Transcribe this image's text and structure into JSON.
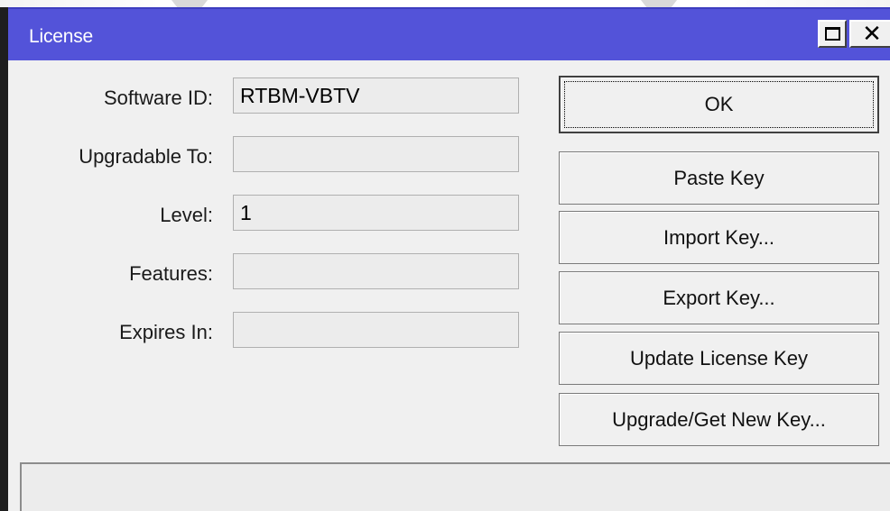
{
  "window": {
    "title": "License"
  },
  "fields": [
    {
      "label": "Software ID:",
      "value": "RTBM-VBTV"
    },
    {
      "label": "Upgradable To:",
      "value": ""
    },
    {
      "label": "Level:",
      "value": "1"
    },
    {
      "label": "Features:",
      "value": ""
    },
    {
      "label": "Expires In:",
      "value": ""
    }
  ],
  "buttons": {
    "ok": "OK",
    "paste_key": "Paste Key",
    "import_key": "Import Key...",
    "export_key": "Export Key...",
    "update_license_key": "Update License Key",
    "upgrade_get_new_key": "Upgrade/Get New Key..."
  },
  "status_bar": {
    "text": ""
  },
  "colors": {
    "titlebar": "#5353d9",
    "window_bg": "#f0f0f0",
    "field_bg": "#ececec"
  }
}
